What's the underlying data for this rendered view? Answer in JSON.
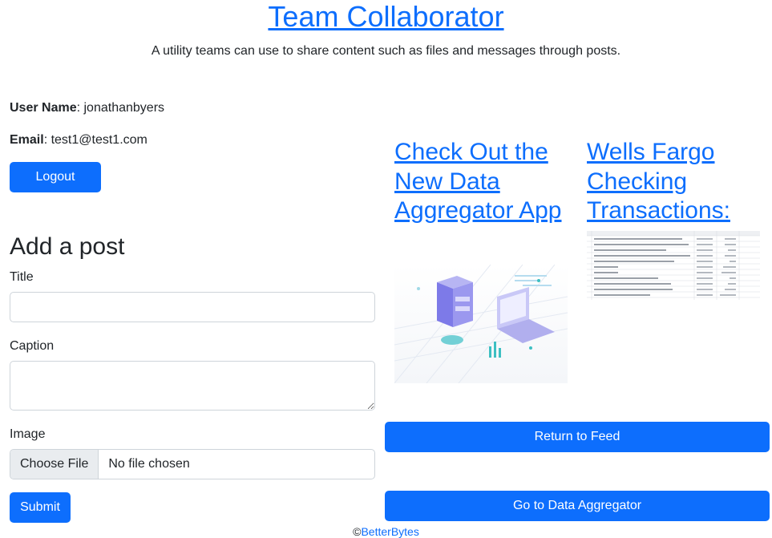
{
  "header": {
    "title": "Team Collaborator",
    "subtitle": "A utility teams can use to share content such as files and messages through posts."
  },
  "profile": {
    "username_label": "User Name",
    "username": "jonathanbyers",
    "email_label": "Email",
    "email": "test1@test1.com",
    "logout_label": "Logout"
  },
  "add_post": {
    "heading": "Add a post",
    "title_label": "Title",
    "title_value": "",
    "caption_label": "Caption",
    "caption_value": "",
    "image_label": "Image",
    "choose_file_label": "Choose File",
    "no_file_text": "No file chosen",
    "submit_label": "Submit"
  },
  "posts": [
    {
      "title": "Check Out the New Data Aggregator App",
      "image": "data-storage-illustration"
    },
    {
      "title": "Wells Fargo Checking Transactions:",
      "image": "spreadsheet-thumbnail"
    }
  ],
  "actions": {
    "return_feed_label": "Return to Feed",
    "go_aggregator_label": "Go to Data Aggregator"
  },
  "footer": {
    "copyright_symbol": "©",
    "brand_link": "BetterBytes"
  },
  "colors": {
    "primary": "#0d6efd",
    "text": "#212529",
    "border": "#ced4da"
  }
}
